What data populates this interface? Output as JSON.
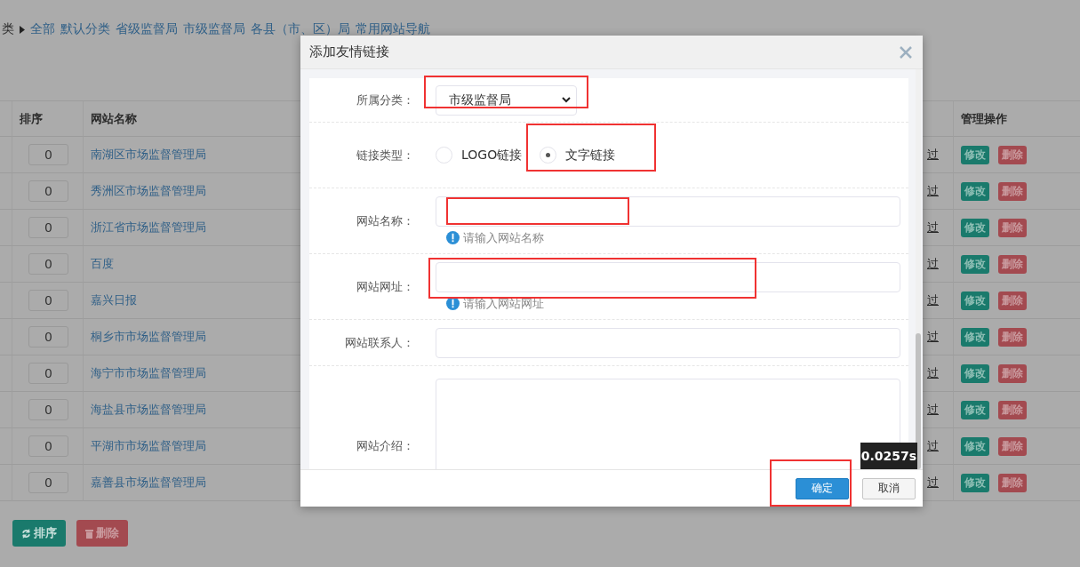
{
  "breadcrumb": {
    "lead": "类",
    "items": [
      "全部",
      "默认分类",
      "省级监督局",
      "市级监督局",
      "各县（市、区）局",
      "常用网站导航"
    ]
  },
  "table": {
    "columns": [
      "排序",
      "网站名称",
      "管理操作"
    ],
    "rows": [
      {
        "order": "0",
        "name": "南湖区市场监督管理局",
        "column_4": "过",
        "actions": [
          "修改",
          "删除"
        ]
      },
      {
        "order": "0",
        "name": "秀洲区市场监督管理局",
        "column_4": "过",
        "actions": [
          "修改",
          "删除"
        ]
      },
      {
        "order": "0",
        "name": "浙江省市场监督管理局",
        "column_4": "过",
        "actions": [
          "修改",
          "删除"
        ]
      },
      {
        "order": "0",
        "name": "百度",
        "column_4": "过",
        "actions": [
          "修改",
          "删除"
        ]
      },
      {
        "order": "0",
        "name": "嘉兴日报",
        "column_4": "过",
        "actions": [
          "修改",
          "删除"
        ]
      },
      {
        "order": "0",
        "name": "桐乡市市场监督管理局",
        "column_4": "过",
        "actions": [
          "修改",
          "删除"
        ]
      },
      {
        "order": "0",
        "name": "海宁市市场监督管理局",
        "column_4": "过",
        "actions": [
          "修改",
          "删除"
        ]
      },
      {
        "order": "0",
        "name": "海盐县市场监督管理局",
        "column_4": "过",
        "actions": [
          "修改",
          "删除"
        ]
      },
      {
        "order": "0",
        "name": "平湖市市场监督管理局",
        "column_4": "过",
        "actions": [
          "修改",
          "删除"
        ]
      },
      {
        "order": "0",
        "name": "嘉善县市场监督管理局",
        "column_4": "过",
        "actions": [
          "修改",
          "删除"
        ]
      }
    ]
  },
  "bulk_buttons": [
    {
      "kind": "sort",
      "label": "排序"
    },
    {
      "kind": "delete",
      "label": "删除"
    }
  ],
  "dialog": {
    "title": "添加友情链接",
    "fields": [
      {
        "kind": "select",
        "label": "所属分类：",
        "value": "市级监督局"
      },
      {
        "kind": "radio",
        "label": "链接类型：",
        "options": [
          {
            "label": "LOGO链接",
            "selected": false
          },
          {
            "label": "文字链接",
            "selected": true
          }
        ]
      },
      {
        "kind": "input",
        "label": "网站名称：",
        "hint": "请输入网站名称"
      },
      {
        "kind": "input",
        "label": "网站网址：",
        "hint": "请输入网站网址"
      },
      {
        "kind": "input",
        "label": "网站联系人："
      },
      {
        "kind": "textarea",
        "label": "网站介绍："
      }
    ],
    "buttons": [
      {
        "kind": "primary",
        "label": "确定"
      },
      {
        "kind": "default",
        "label": "取消"
      }
    ]
  },
  "timer_badge": "0.0257s"
}
